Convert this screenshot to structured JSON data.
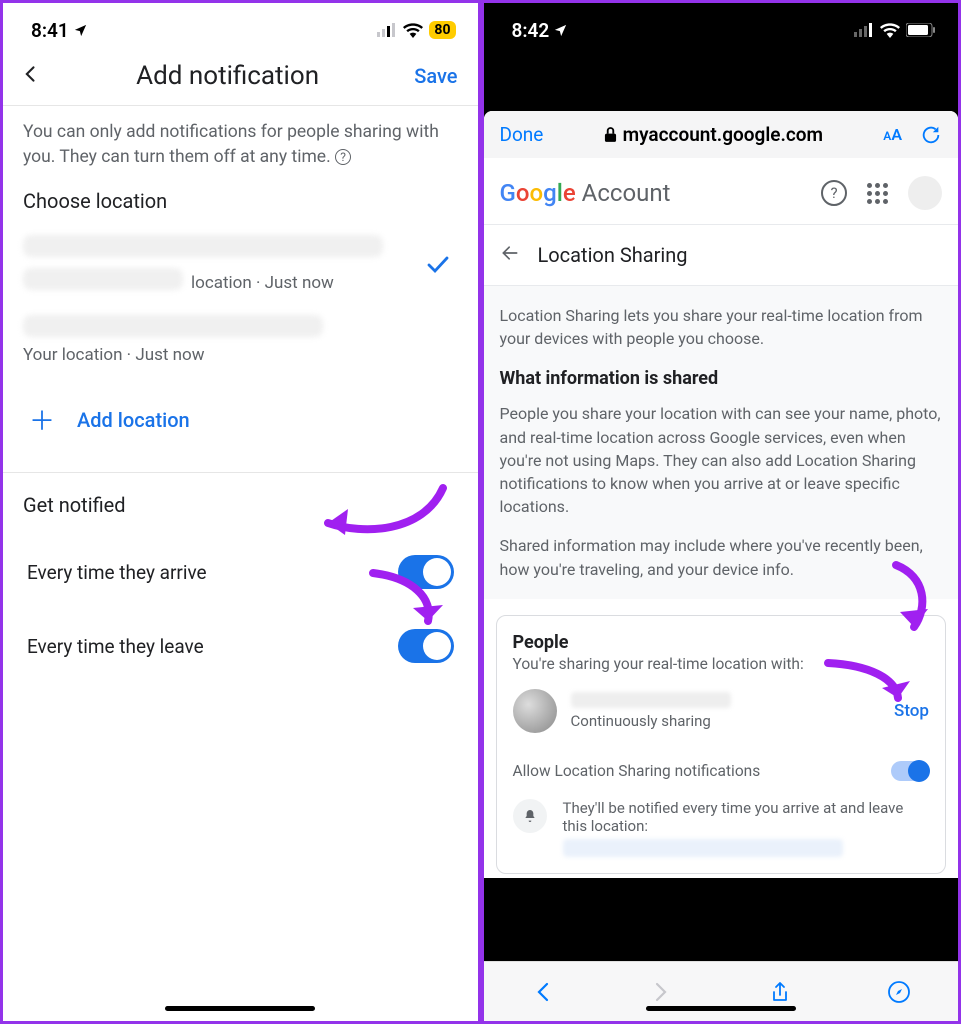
{
  "left": {
    "status": {
      "time": "8:41",
      "battery": "80"
    },
    "nav": {
      "title": "Add notification",
      "save": "Save"
    },
    "help_text": "You can only add notifications for people sharing with you. They can turn them off at any time.",
    "choose_location": "Choose location",
    "loc1_sub_prefix": "location",
    "loc1_sub_time": "Just now",
    "loc2_sub": "Your location · Just now",
    "add_location": "Add location",
    "get_notified": "Get notified",
    "row_arrive": "Every time they arrive",
    "row_leave": "Every time they leave"
  },
  "right": {
    "status": {
      "time": "8:42"
    },
    "safari": {
      "done": "Done",
      "url": "myaccount.google.com",
      "aa": "AA"
    },
    "account_label": "Account",
    "page_title": "Location Sharing",
    "intro": "Location Sharing lets you share your real-time location from your devices with people you choose.",
    "what_shared_heading": "What information is shared",
    "what_shared_body": "People you share your location with can see your name, photo, and real-time location across Google services, even when you're not using Maps. They can also add Location Sharing notifications to know when you arrive at or leave specific locations.",
    "shared_info": "Shared information may include where you've recently been, how you're traveling, and your device info.",
    "people_heading": "People",
    "people_sub": "You're sharing your real-time location with:",
    "person_status": "Continuously sharing",
    "stop": "Stop",
    "allow_label": "Allow Location Sharing notifications",
    "notif_detail": "They'll be notified every time you arrive at and leave this location:"
  }
}
